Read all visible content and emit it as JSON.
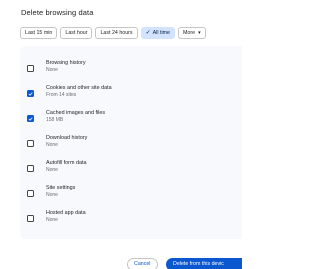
{
  "dialog": {
    "title": "Delete browsing data"
  },
  "time_range": {
    "chips": [
      {
        "label": "Last 15 min",
        "selected": false
      },
      {
        "label": "Last hour",
        "selected": false
      },
      {
        "label": "Last 24 hours",
        "selected": false
      },
      {
        "label": "All time",
        "selected": true
      },
      {
        "label": "More",
        "selected": false
      }
    ]
  },
  "items": [
    {
      "title": "Browsing history",
      "subtitle": "None",
      "checked": false
    },
    {
      "title": "Cookies and other site data",
      "subtitle": "From 14 sites",
      "checked": true
    },
    {
      "title": "Cached images and files",
      "subtitle": "158 MB",
      "checked": true
    },
    {
      "title": "Download history",
      "subtitle": "None",
      "checked": false
    },
    {
      "title": "Autofill form data",
      "subtitle": "None",
      "checked": false
    },
    {
      "title": "Site settings",
      "subtitle": "None",
      "checked": false
    },
    {
      "title": "Hosted app data",
      "subtitle": "None",
      "checked": false
    }
  ],
  "footer": {
    "cancel_label": "Cancel",
    "delete_label": "Delete from this devic"
  },
  "colors": {
    "accent": "#0b57d0",
    "selected_chip_bg": "#d3e3fd",
    "list_bg": "#f7f9fc"
  }
}
